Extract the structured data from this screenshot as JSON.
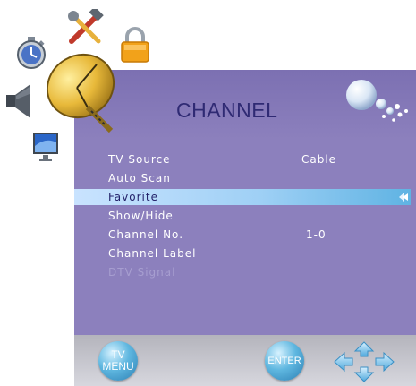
{
  "menu": {
    "title": "CHANNEL",
    "items": [
      {
        "label": "TV Source",
        "value": "Cable",
        "state": "normal"
      },
      {
        "label": "Auto Scan",
        "value": "",
        "state": "normal"
      },
      {
        "label": "Favorite",
        "value": "",
        "state": "selected"
      },
      {
        "label": "Show/Hide",
        "value": "",
        "state": "normal"
      },
      {
        "label": "Channel No.",
        "value": "1-0",
        "state": "normal"
      },
      {
        "label": "Channel Label",
        "value": "",
        "state": "normal"
      },
      {
        "label": "DTV Signal",
        "value": "",
        "state": "disabled"
      }
    ]
  },
  "footer": {
    "menu_button_top": "TV",
    "menu_button_bottom": "MENU",
    "enter_button": "ENTER"
  },
  "side_icons": [
    "timer-icon",
    "tools-icon",
    "lock-icon",
    "speaker-icon",
    "monitor-icon",
    "satellite-dish-icon"
  ],
  "colors": {
    "panel": "#8c80bd",
    "title": "#2f2a73",
    "highlight": "#9fd0f5",
    "button": "#3a8fc4",
    "footer": "#c6c6cd"
  }
}
